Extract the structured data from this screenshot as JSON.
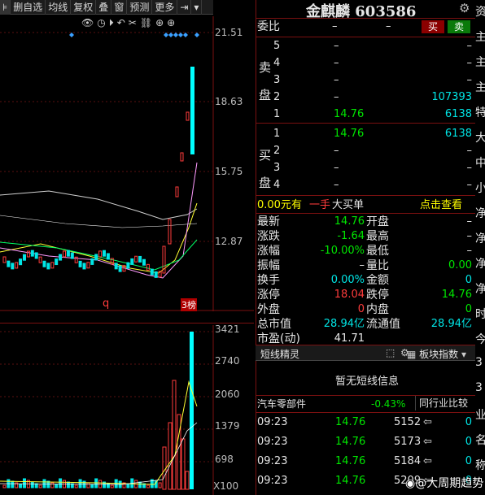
{
  "toolbar": {
    "items": [
      "删自选",
      "均线",
      "复权",
      "叠",
      "窗",
      "预测",
      "更多"
    ],
    "arrow_glyph": "▸"
  },
  "kline": {
    "price_axis": [
      "21.51",
      "18.63",
      "15.75",
      "12.87"
    ],
    "low_marker": "q",
    "badge": "3榜"
  },
  "volume": {
    "axis": [
      "3421",
      "2740",
      "2060",
      "1379",
      "698",
      "X100"
    ]
  },
  "header": {
    "name": "金麒麟 603586",
    "settings_icon": "gear-icon"
  },
  "orderbook": {
    "ratio_label": "委比",
    "ratio_value1": "–",
    "ratio_value2": "–",
    "buy_btn": "买",
    "sell_btn": "卖",
    "sell_side": [
      "卖",
      "盘"
    ],
    "buy_side": [
      "买",
      "盘"
    ],
    "asks": [
      {
        "level": "5",
        "price": "–",
        "vol": "–"
      },
      {
        "level": "4",
        "price": "–",
        "vol": "–"
      },
      {
        "level": "3",
        "price": "–",
        "vol": "–"
      },
      {
        "level": "2",
        "price": "–",
        "vol": "107393"
      },
      {
        "level": "1",
        "price": "14.76",
        "vol": "6138"
      }
    ],
    "bids": [
      {
        "level": "1",
        "price": "14.76",
        "vol": "6138"
      },
      {
        "level": "2",
        "price": "–",
        "vol": "–"
      },
      {
        "level": "3",
        "price": "–",
        "vol": "–"
      },
      {
        "level": "4",
        "price": "–",
        "vol": "–"
      }
    ]
  },
  "bigbuy": {
    "amount": "0.00元有",
    "hands": "一手",
    "label": "大买单",
    "link": "点击查看"
  },
  "quote": {
    "rows": [
      {
        "l": "最新",
        "lv": "14.76",
        "r": "开盘",
        "rv": "–"
      },
      {
        "l": "涨跌",
        "lv": "-1.64",
        "r": "最高",
        "rv": "–"
      },
      {
        "l": "涨幅",
        "lv": "-10.00%",
        "r": "最低",
        "rv": "–"
      },
      {
        "l": "振幅",
        "lv": "–",
        "r": "量比",
        "rv": "0.00"
      },
      {
        "l": "换手",
        "lv": "0.00%",
        "r": "金额",
        "rv": "0"
      },
      {
        "l": "涨停",
        "lv": "18.04",
        "r": "跌停",
        "rv": "14.76"
      },
      {
        "l": "外盘",
        "lv": "0",
        "r": "内盘",
        "rv": "0"
      },
      {
        "l": "总市值",
        "lv": "28.94亿",
        "r": "流通值",
        "rv": "28.94亿"
      },
      {
        "l": "市盈(动)",
        "lv": "41.71",
        "r": "",
        "rv": ""
      }
    ]
  },
  "elves": {
    "title": "短线精灵",
    "board_label": "板块指数",
    "empty_text": "暂无短线信息"
  },
  "sector": {
    "name": "汽车零部件",
    "change": "-0.43%",
    "compare_label": "同行业比较"
  },
  "ticks": [
    {
      "time": "09:23",
      "price": "14.76",
      "vol": "5152",
      "n": "0"
    },
    {
      "time": "09:23",
      "price": "14.76",
      "vol": "5173",
      "n": "0"
    },
    {
      "time": "09:23",
      "price": "14.76",
      "vol": "5184",
      "n": "0"
    },
    {
      "time": "09:23",
      "price": "14.76",
      "vol": "5209",
      "n": "0"
    }
  ],
  "watermark": "@大周期趋势",
  "side_strip": [
    "资",
    "主",
    "主",
    "主",
    "特",
    "大",
    "中",
    "小",
    "净",
    "净",
    "净",
    "净",
    "时",
    "今",
    "3",
    "3",
    "业",
    "名",
    "称"
  ],
  "colors": {
    "up": "#ff3c3c",
    "down": "#00e600",
    "accent": "#00e5e5",
    "border": "#7a1010"
  }
}
